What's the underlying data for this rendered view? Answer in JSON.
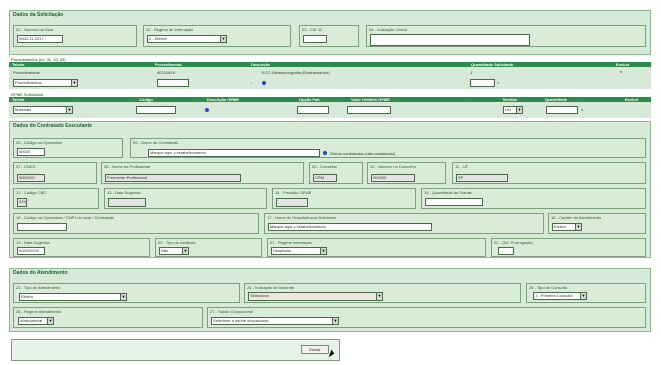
{
  "dados_solicitacao": {
    "title": "Dados da Solicitação",
    "numero": {
      "label": "01 - Número da Guia",
      "value": "0000-11-2017"
    },
    "tipo_internacao": {
      "label": "02 - Regime de Internação",
      "value": "2 - Eletiva"
    },
    "cid": {
      "label": "03 - CID 10",
      "value": ""
    },
    "indicacao": {
      "label": "04 - Indicação Clínica",
      "value": ""
    }
  },
  "procedimentos": {
    "title": "Procedimentos (ex: 31, 32, 33)",
    "headers": [
      "Tabela",
      "Procedimento",
      "Descrição",
      "Quantidade Solicitada",
      "Excluir"
    ],
    "row": {
      "tabela": "Procedimentos",
      "procedimento": "40701819",
      "descricao": "ECO Ultrassonografia (Ecotransdutor)",
      "quantidade": "1",
      "excluir": "x"
    },
    "new_row": {
      "tabela": "Procedimentos",
      "procedimento": "",
      "quantidade": ""
    }
  },
  "opme": {
    "title": "OPME Solicitados",
    "headers": [
      "Tabela",
      "Código",
      "Descrição OPME",
      "Opção Fab.",
      "Valor Unitário OPME",
      "Medida",
      "Quantidade",
      "Excluir"
    ],
    "row": {
      "tabela": "Materiais",
      "codigo": "",
      "opcao": "",
      "valor": "",
      "medida": "UN",
      "quantidade": ""
    }
  },
  "contratado_executante": {
    "title": "Dados do Contratado Executante",
    "codigo_operadora": {
      "label": "05 - Código na Operadora",
      "value": "00000"
    },
    "nome_contratado": {
      "label": "06 - Nome do Contratado",
      "value": "Marque aqui o estabelecimento"
    },
    "outro_lugar": "Outros contratados (não cadastrado)",
    "cnes": {
      "label": "07 - CNES",
      "value": "0000000"
    },
    "nome_profissional": {
      "label": "08 - Nome do Profissional",
      "value": "Preencher Profissional"
    },
    "conselho": {
      "label": "09 - Conselho",
      "value": "CRM"
    },
    "numero_conselho": {
      "label": "10 - Número no Conselho",
      "value": "000000"
    },
    "uf": {
      "label": "11 - UF",
      "value": "SP"
    },
    "cbo": {
      "label": "12 - Código CBO",
      "value": "225125"
    },
    "data_sugerida": {
      "label": "13 - Data Sugerida",
      "value": ""
    },
    "previsao_opme": {
      "label": "14 - Previsão OPME",
      "value": ""
    },
    "qtd_diarias": {
      "label": "15 - Quantidade de Diárias",
      "value": ""
    },
    "cnpj_prestador": {
      "label": "16 - Código na Operadora / CNPJ do local / Contratado",
      "value": ""
    },
    "nome_hospital": {
      "label": "17 - Nome do Hospital/Local Solicitado",
      "value": "Marque aqui o estabelecimento"
    },
    "carater": {
      "label": "18 - Caráter do Atendimento",
      "value": "Eletivo"
    },
    "data_sugerida_int": {
      "label": "19 - Data Sugerida",
      "value": "00/00/0000"
    },
    "tipo_acidente": {
      "label": "20 - Tipo de Acidente",
      "value": "Não"
    },
    "regime": {
      "label": "21 - Regime Internação",
      "value": "Hospitalar"
    },
    "qtd_prorrogacao": {
      "label": "22 - Qtd. Prorrogação",
      "value": ""
    }
  },
  "atendimento": {
    "title": "Dados do Atendimento",
    "tipo_atendimento": {
      "label": "23 - Tipo de Atendimento",
      "value": "Eletivo"
    },
    "indicacao_acidente": {
      "label": "24 - Indicação de Acidente",
      "value": "Selecionar"
    },
    "tipo_consulta": {
      "label": "25 - Tipo de Consulta",
      "value": "1 - Primeira Consulta"
    },
    "regime_atendimento": {
      "label": "26 - Regime Atendimento",
      "value": "Ambulatorial"
    },
    "saude_ocupacional": {
      "label": "27 - Saúde Ocupacional",
      "value": "Selecione a saúde ocupacional"
    }
  },
  "enviar_label": "Enviar",
  "colors": {
    "section_bg": "#d7ead7",
    "header_bar": "#2e8b4e",
    "border": "#7fa07f",
    "radio": "#2244cc"
  }
}
